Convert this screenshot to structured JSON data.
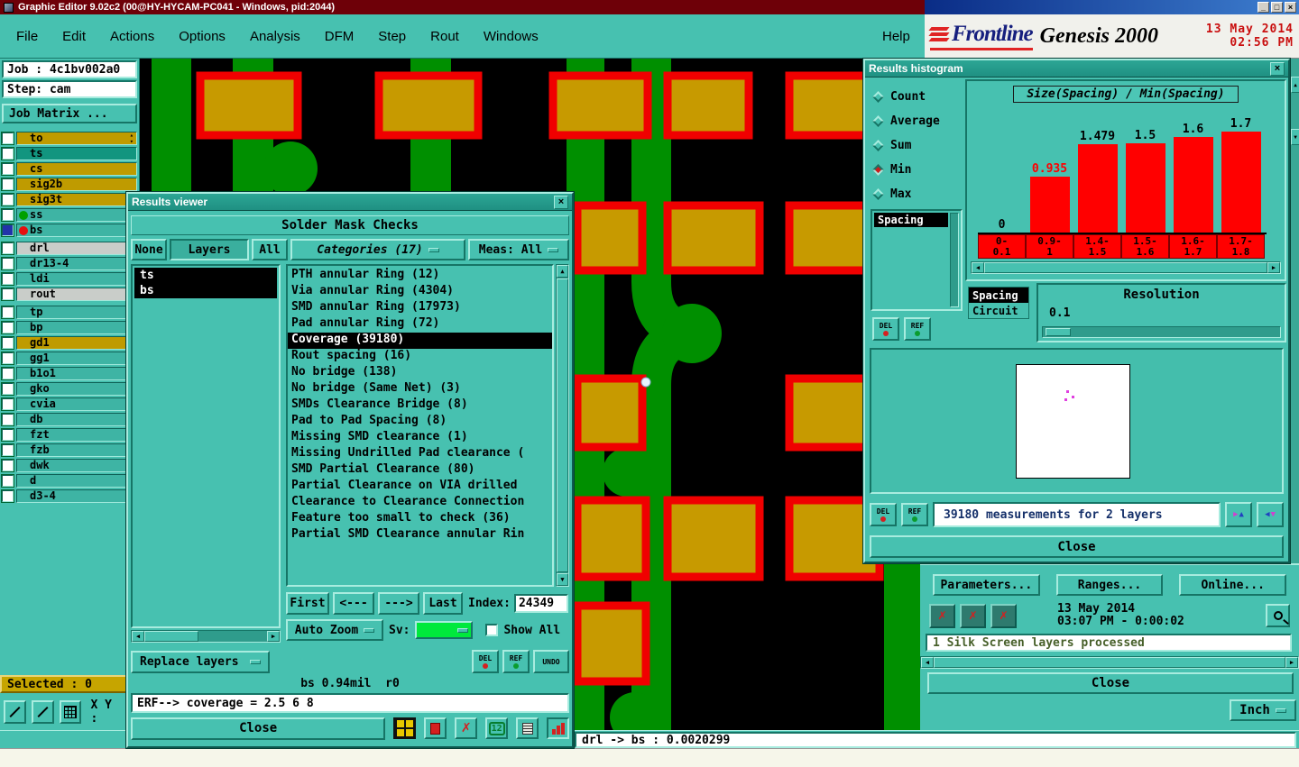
{
  "titlebar": {
    "title": "Graphic Editor 9.02c2 (00@HY-HYCAM-PC041 - Windows, pid:2044)"
  },
  "background_window": {
    "minimize": "_",
    "maximize": "□",
    "close": "×"
  },
  "menubar": {
    "items": [
      "File",
      "Edit",
      "Actions",
      "Options",
      "Analysis",
      "DFM",
      "Step",
      "Rout",
      "Windows"
    ],
    "help": "Help"
  },
  "header": {
    "brand": "Frontline",
    "product": "Genesis 2000",
    "date": "13 May 2014",
    "time": "02:56 PM"
  },
  "sidebar": {
    "job": "Job : 4c1bv002a0",
    "step": "Step: cam",
    "job_matrix": "Job Matrix ...",
    "selected": "Selected : 0",
    "xy_label": "X Y :",
    "layers": [
      {
        "name": "to",
        "type": "gold",
        "spinner": true
      },
      {
        "name": "ts",
        "type": "teal2"
      },
      {
        "name": "cs",
        "type": "gold"
      },
      {
        "name": "sig2b",
        "type": "gold"
      },
      {
        "name": "sig3t",
        "type": "gold"
      },
      {
        "name": "ss",
        "type": "teal",
        "dot": "#00a000"
      },
      {
        "name": "bs",
        "type": "teal",
        "dot": "#e61010",
        "selected": true
      },
      {
        "name": "drl",
        "type": "light",
        "gap": true
      },
      {
        "name": "dr13-4",
        "type": "teal"
      },
      {
        "name": "ldi",
        "type": "teal"
      },
      {
        "name": "rout",
        "type": "light"
      },
      {
        "name": "tp",
        "type": "teal",
        "gap": true
      },
      {
        "name": "bp",
        "type": "teal"
      },
      {
        "name": "gd1",
        "type": "gold"
      },
      {
        "name": "gg1",
        "type": "teal"
      },
      {
        "name": "b1o1",
        "type": "teal"
      },
      {
        "name": "gko",
        "type": "teal"
      },
      {
        "name": "cvia",
        "type": "teal"
      },
      {
        "name": "db",
        "type": "teal"
      },
      {
        "name": "fzt",
        "type": "teal"
      },
      {
        "name": "fzb",
        "type": "teal"
      },
      {
        "name": "dwk",
        "type": "teal"
      },
      {
        "name": "d",
        "type": "teal"
      },
      {
        "name": "d3-4",
        "type": "teal"
      }
    ]
  },
  "results_viewer": {
    "title": "Results viewer",
    "header": "Solder Mask Checks",
    "filters": [
      "None",
      "Layers",
      "All"
    ],
    "active_filter": "Layers",
    "categories_combo": "Categories (17)",
    "meas_label": "Meas:",
    "meas_value": "All",
    "layers": [
      "ts",
      "bs"
    ],
    "categories": [
      "PTH annular Ring (12)",
      "Via annular Ring (4304)",
      "SMD annular Ring (17973)",
      "Pad annular Ring (72)",
      "Coverage (39180)",
      "Rout spacing (16)",
      "No bridge (138)",
      "No bridge (Same Net) (3)",
      "SMDs Clearance Bridge (8)",
      "Pad to Pad Spacing (8)",
      "Missing SMD clearance (1)",
      "Missing Undrilled Pad clearance (",
      "SMD Partial Clearance (80)",
      "Partial Clearance on VIA drilled",
      "Clearance to Clearance Connection",
      "Feature too small to check (36)",
      "Partial SMD Clearance annular Rin"
    ],
    "selected_category": "Coverage (39180)",
    "nav_first": "First",
    "nav_prev": "<---",
    "nav_next": "--->",
    "nav_last": "Last",
    "index_label": "Index:",
    "index_value": "24349",
    "auto_zoom": "Auto Zoom",
    "sv_label": "Sv:",
    "show_all": "Show All",
    "replace_layers": "Replace layers",
    "del": "DEL",
    "ref": "REF",
    "undo": "UNDO",
    "icon_12": "12",
    "measure_info": "bs 0.94mil  r0",
    "erf_text": "ERF--> coverage = 2.5 6 8",
    "close": "Close"
  },
  "histogram_window": {
    "title": "Results histogram",
    "stats": [
      "Count",
      "Average",
      "Sum",
      "Min",
      "Max"
    ],
    "selected_stat": "Min",
    "measure_list": [
      "Spacing"
    ],
    "sub_list": [
      "Spacing",
      "Circuit"
    ],
    "resolution_label": "Resolution",
    "resolution_value": "0.1",
    "del": "DEL",
    "ref": "REF",
    "measurements_text": "39180 measurements for 2 layers",
    "close": "Close"
  },
  "chart_data": {
    "type": "bar",
    "title": "Size(Spacing) / Min(Spacing)",
    "categories": [
      "0-0.1",
      "0.9-1",
      "1.4-1.5",
      "1.5-1.6",
      "1.6-1.7",
      "1.7-1.8"
    ],
    "values": [
      0,
      0.935,
      1.479,
      1.5,
      1.6,
      1.7
    ],
    "bar_labels": [
      "0",
      "0.935",
      "1.479",
      "1.5",
      "1.6",
      "1.7"
    ],
    "cat_lines": [
      [
        "0-",
        "0.1"
      ],
      [
        "0.9-",
        "1"
      ],
      [
        "1.4-",
        "1.5"
      ],
      [
        "1.5-",
        "1.6"
      ],
      [
        "1.6-",
        "1.7"
      ],
      [
        "1.7-",
        "1.8"
      ]
    ],
    "xlabel": "",
    "ylabel": "",
    "ylim": [
      0,
      1.8
    ],
    "bar_color": "#ff0000",
    "highlight_index": 1,
    "highlight_color": "#ff0000",
    "legend": false
  },
  "process_panel": {
    "buttons": [
      "Parameters...",
      "Ranges...",
      "Online..."
    ],
    "date": "13 May 2014",
    "time": "03:07 PM - 0:00:02",
    "status": "1 Silk Screen layers processed",
    "close": "Close"
  },
  "statusbar": {
    "message": "drl -> bs : 0.0020299"
  },
  "units_button": {
    "label": "Inch"
  },
  "icons": {
    "close": "×",
    "up": "▲",
    "down": "▼",
    "left": "◀",
    "right": "▶",
    "spinner_up": "▴",
    "spinner_down": "▾",
    "x_mark": "✗"
  }
}
